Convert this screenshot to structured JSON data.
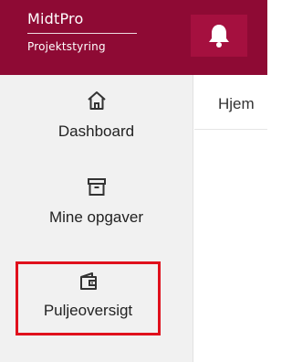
{
  "header": {
    "brand_title": "MidtPro",
    "brand_subtitle": "Projektstyring",
    "bell_icon": "bell-icon"
  },
  "sidebar": {
    "items": [
      {
        "label": "Dashboard",
        "icon": "home-icon",
        "highlighted": false
      },
      {
        "label": "Mine opgaver",
        "icon": "archive-box-icon",
        "highlighted": true
      },
      {
        "label": "Puljeoversigt",
        "icon": "wallet-icon",
        "highlighted": true
      }
    ]
  },
  "main": {
    "breadcrumb": "Hjem"
  },
  "colors": {
    "header_bg": "#8e0a34",
    "bell_button_bg": "#a5103f",
    "sidebar_bg": "#f1f1f1",
    "highlight_border": "#e0101c"
  }
}
